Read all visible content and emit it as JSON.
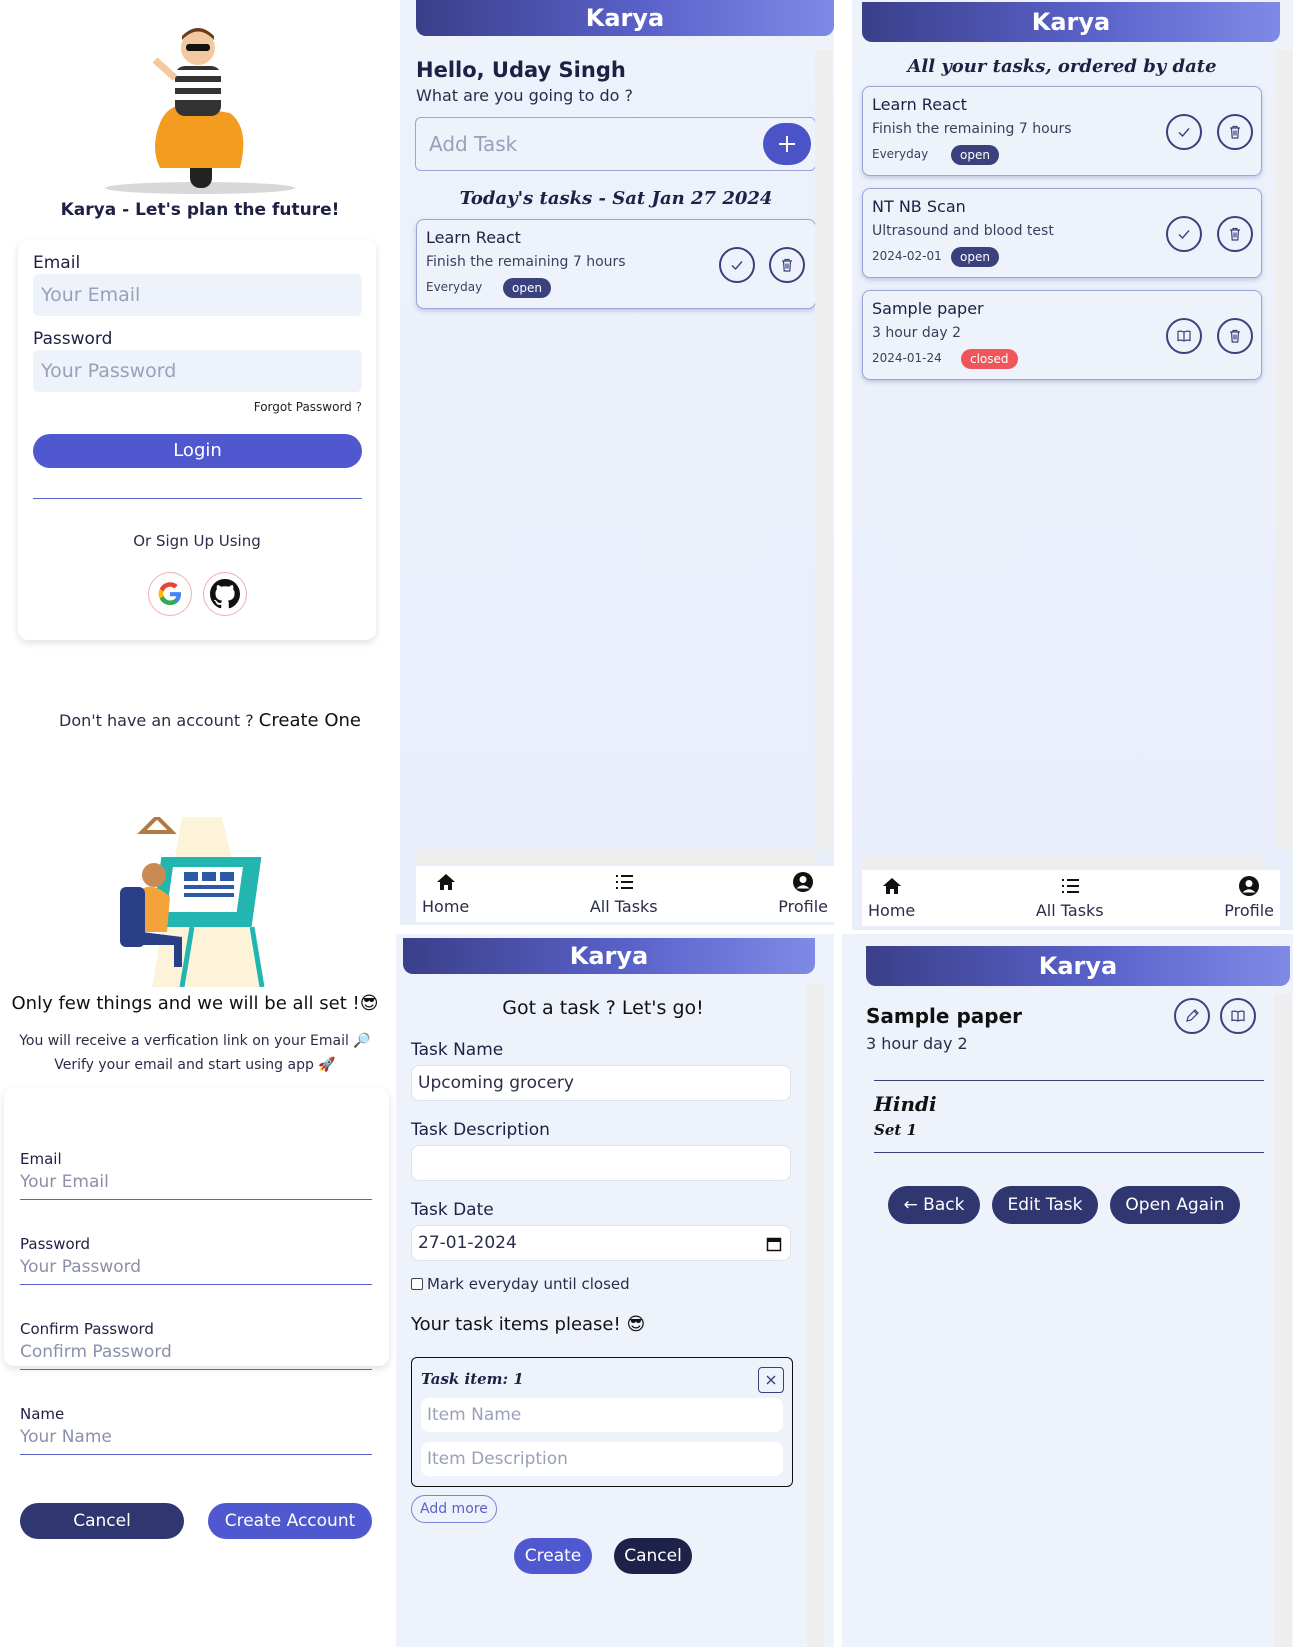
{
  "brand": {
    "name": "Karya"
  },
  "login": {
    "tagline": "Karya - Let's plan the future!",
    "email_label": "Email",
    "email_placeholder": "Your Email",
    "password_label": "Password",
    "password_placeholder": "Your Password",
    "forgot": "Forgot Password ?",
    "login_button": "Login",
    "or_signup": "Or Sign Up Using",
    "no_account": "Don't have an account ?",
    "create_one": "Create One"
  },
  "home": {
    "greeting": "Hello, Uday Singh",
    "subtitle": "What are you going to do ?",
    "add_placeholder": "Add Task",
    "today_heading": "Today's tasks - Sat Jan 27 2024",
    "tasks": [
      {
        "title": "Learn React",
        "description": "Finish the remaining 7 hours",
        "date": "Everyday",
        "status": "open"
      }
    ]
  },
  "nav": {
    "home": "Home",
    "all_tasks": "All Tasks",
    "profile": "Profile"
  },
  "all_tasks": {
    "heading": "All your tasks, ordered by date",
    "tasks": [
      {
        "title": "Learn React",
        "description": "Finish the remaining 7 hours",
        "date": "Everyday",
        "status": "open"
      },
      {
        "title": "NT NB Scan",
        "description": "Ultrasound and blood test",
        "date": "2024-02-01",
        "status": "open"
      },
      {
        "title": "Sample paper",
        "description": "3 hour day 2",
        "date": "2024-01-24",
        "status": "closed"
      }
    ]
  },
  "signup": {
    "heading": "Only few things and we will be all set !😎",
    "info_line1": "You will receive a verfication link on your Email 🔎",
    "info_line2": "Verify your email and start using app 🚀",
    "email_label": "Email",
    "email_placeholder": "Your Email",
    "password_label": "Password",
    "password_placeholder": "Your Password",
    "confirm_label": "Confirm Password",
    "confirm_placeholder": "Confirm Password",
    "name_label": "Name",
    "name_placeholder": "Your Name",
    "cancel": "Cancel",
    "create_account": "Create Account"
  },
  "create": {
    "heading": "Got a task ? Let's go!",
    "name_label": "Task Name",
    "name_value": "Upcoming grocery",
    "desc_label": "Task Description",
    "desc_value": "",
    "date_label": "Task Date",
    "date_value": "27-01-2024",
    "everyday_label": "Mark everyday until closed",
    "items_heading": "Your task items please! 😎",
    "item_title": "Task item: 1",
    "item_name_placeholder": "Item Name",
    "item_desc_placeholder": "Item Description",
    "add_more": "Add more",
    "create_button": "Create",
    "cancel_button": "Cancel"
  },
  "detail": {
    "title": "Sample paper",
    "description": "3 hour day 2",
    "item_name": "Hindi",
    "item_desc": "Set 1",
    "back": "← Back",
    "edit": "Edit Task",
    "open_again": "Open Again"
  },
  "colors": {
    "primary": "#5058d0",
    "dark": "#3a417c",
    "danger": "#f0555a",
    "panel_bg": "#edf2fb"
  }
}
